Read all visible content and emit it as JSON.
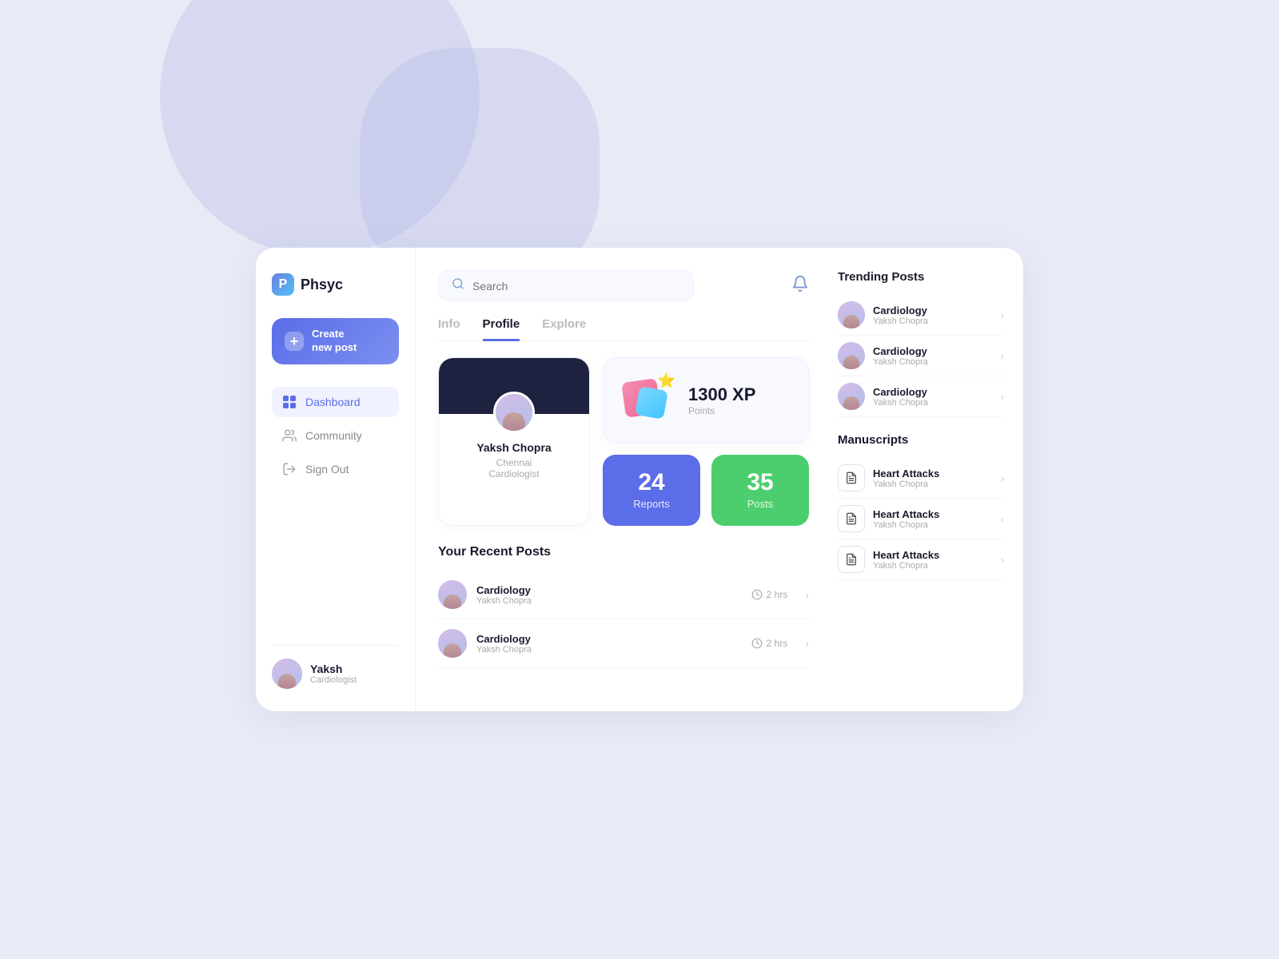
{
  "app": {
    "logo_letter": "P",
    "logo_text": "Phsyc"
  },
  "sidebar": {
    "create_button": "Create\nnew post",
    "nav_items": [
      {
        "id": "dashboard",
        "label": "Dashboard",
        "active": true
      },
      {
        "id": "community",
        "label": "Community",
        "active": false
      },
      {
        "id": "signout",
        "label": "Sign Out",
        "active": false
      }
    ],
    "user": {
      "name": "Yaksh",
      "role": "Cardiologist"
    }
  },
  "header": {
    "search_placeholder": "Search",
    "search_value": ""
  },
  "tabs": [
    {
      "id": "info",
      "label": "Info",
      "active": false
    },
    {
      "id": "profile",
      "label": "Profile",
      "active": true
    },
    {
      "id": "explore",
      "label": "Explore",
      "active": false
    }
  ],
  "profile": {
    "name": "Yaksh Chopra",
    "location": "Chennai",
    "specialty": "Cardiologist",
    "xp": {
      "value": "1300 XP",
      "label": "Points"
    },
    "stats": [
      {
        "id": "reports",
        "number": "24",
        "label": "Reports",
        "color": "blue"
      },
      {
        "id": "posts",
        "number": "35",
        "label": "Posts",
        "color": "green"
      }
    ]
  },
  "recent_posts": {
    "title": "Your Recent Posts",
    "items": [
      {
        "title": "Cardiology",
        "author": "Yaksh Chopra",
        "time": "2 hrs"
      },
      {
        "title": "Cardiology",
        "author": "Yaksh Chopra",
        "time": "2 hrs"
      }
    ]
  },
  "trending_posts": {
    "title": "Trending Posts",
    "items": [
      {
        "title": "Cardiology",
        "author": "Yaksh Chopra"
      },
      {
        "title": "Cardiology",
        "author": "Yaksh Chopra"
      },
      {
        "title": "Cardiology",
        "author": "Yaksh Chopra"
      }
    ]
  },
  "manuscripts": {
    "title": "Manuscripts",
    "items": [
      {
        "title": "Heart Attacks",
        "author": "Yaksh Chopra"
      },
      {
        "title": "Heart Attacks",
        "author": "Yaksh Chopra"
      },
      {
        "title": "Heart Attacks",
        "author": "Yaksh Chopra"
      }
    ]
  }
}
